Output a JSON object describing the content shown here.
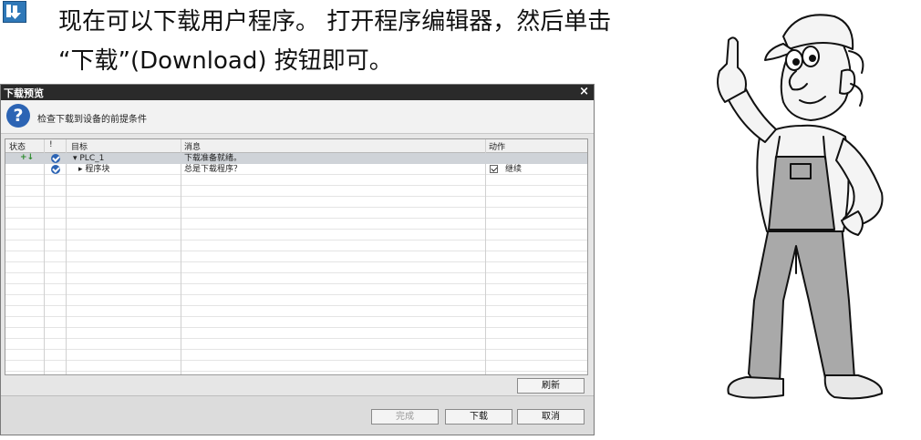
{
  "instruction": {
    "line1": "现在可以下载用户程序。 打开程序编辑器，然后单击",
    "line2": "“下载”(Download) 按钮即可。",
    "icon": "download-icon"
  },
  "dialog": {
    "title": "下载预览",
    "close": "×",
    "header_text": "检查下载到设备的前提条件",
    "header_icon": "question-icon",
    "columns": [
      "状态",
      "!",
      "目标",
      "消息",
      "动作"
    ],
    "rows": [
      {
        "status_icon": "download-arrow-icon",
        "check_icon": "check-circle-icon",
        "target": "▾ PLC_1",
        "message": "下载准备就绪。",
        "action": ""
      },
      {
        "status_icon": "",
        "check_icon": "check-circle-icon",
        "target": "▸ 程序块",
        "message": "总是下载程序？",
        "action": "继续"
      }
    ],
    "buttons": {
      "refresh": "刷新",
      "finish": "完成",
      "download": "下载",
      "cancel": "取消"
    }
  }
}
